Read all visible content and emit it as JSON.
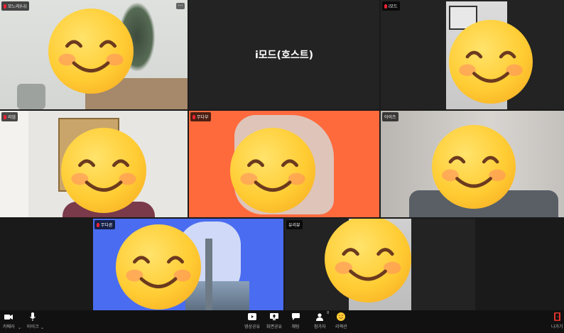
{
  "tiles": [
    {
      "name": "모느리(나)",
      "show_more": true
    },
    {
      "host_name": "i모드(호스트)"
    },
    {
      "name": "i모드"
    },
    {
      "name": "리엄"
    },
    {
      "name": "무다부"
    },
    {
      "name": "아이즈"
    },
    {
      "name": "무다른"
    },
    {
      "name": "유리뷰"
    }
  ],
  "more_glyph": "···",
  "toolbar": {
    "camera_label": "카메라",
    "mic_label": "마이크",
    "video_share_label": "영상공유",
    "screen_share_label": "화면공유",
    "chat_label": "채팅",
    "participants_label": "참가자",
    "participants_count": "8",
    "reaction_label": "리액션",
    "leave_label": "나가기"
  },
  "colors": {
    "orange_bg": "#ff6a3d",
    "blue_bg": "#4a6cf0",
    "leave_red": "#e0352b"
  }
}
